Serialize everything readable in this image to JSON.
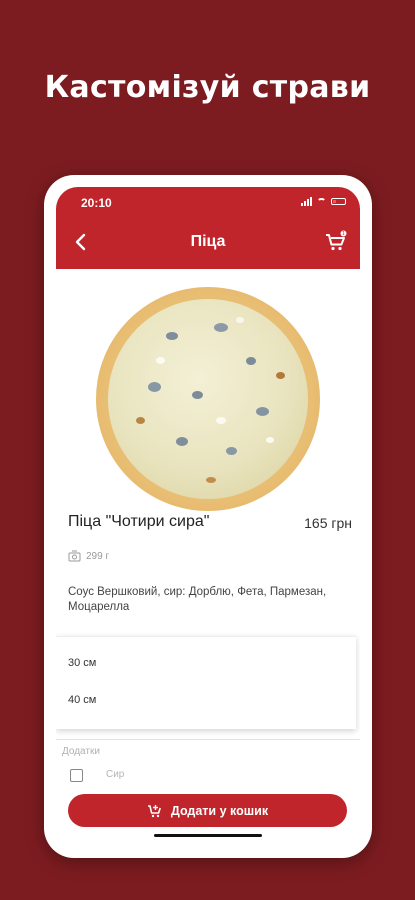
{
  "headline": "Кастомізуй страви",
  "status": {
    "time": "20:10"
  },
  "appbar": {
    "title": "Піца",
    "cart_badge": "1"
  },
  "product": {
    "name": "Піца \"Чотири сира\"",
    "price": "165 грн",
    "weight": "299 г",
    "ingredients": "Соус Вершковий, сир: Дорблю, Фета, Пармезан, Моцарелла"
  },
  "sizes": [
    "30 см",
    "40 см"
  ],
  "extras": {
    "title": "Додатки",
    "item_label": "Сир"
  },
  "add_to_cart_label": "Додати у кошик",
  "colors": {
    "brand_red": "#c0252b",
    "background": "#7d1c20"
  },
  "icons": {
    "back": "chevron-left-icon",
    "cart": "cart-icon",
    "weight": "scale-icon",
    "add": "cart-plus-icon"
  }
}
